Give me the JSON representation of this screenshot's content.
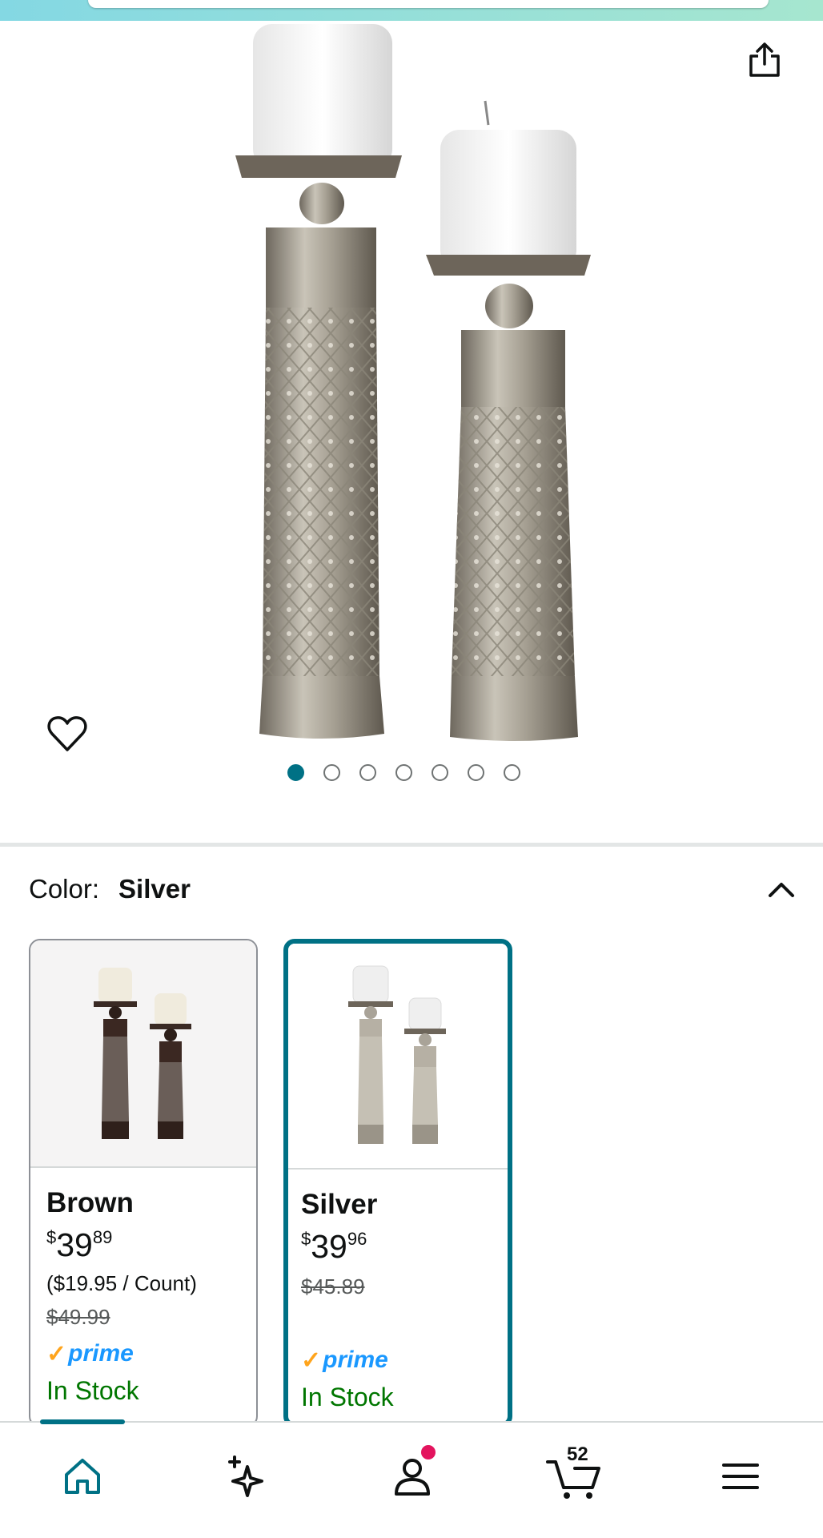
{
  "color_selector": {
    "label": "Color:",
    "selected": "Silver"
  },
  "gallery": {
    "image_count": 7,
    "active_index": 0
  },
  "variants": [
    {
      "name": "Brown",
      "price_symbol": "$",
      "price_whole": "39",
      "price_fraction": "89",
      "unit_price": "($19.95 / Count)",
      "list_price": "$49.99",
      "prime_label": "prime",
      "availability": "In Stock",
      "selected": false
    },
    {
      "name": "Silver",
      "price_symbol": "$",
      "price_whole": "39",
      "price_fraction": "96",
      "list_price": "$45.89",
      "prime_label": "prime",
      "availability": "In Stock",
      "selected": true
    }
  ],
  "bottom_nav": {
    "items": [
      {
        "icon": "home-icon",
        "active": true
      },
      {
        "icon": "sparkle-icon",
        "active": false
      },
      {
        "icon": "account-icon",
        "active": false,
        "has_notification": true
      },
      {
        "icon": "cart-icon",
        "active": false
      },
      {
        "icon": "menu-icon",
        "active": false
      }
    ],
    "cart_count": "52"
  },
  "colors": {
    "accent": "#007185",
    "stock_green": "#007600",
    "prime_blue": "#1a98ff",
    "prime_check": "#ffa41c",
    "notification": "#e3145e"
  }
}
